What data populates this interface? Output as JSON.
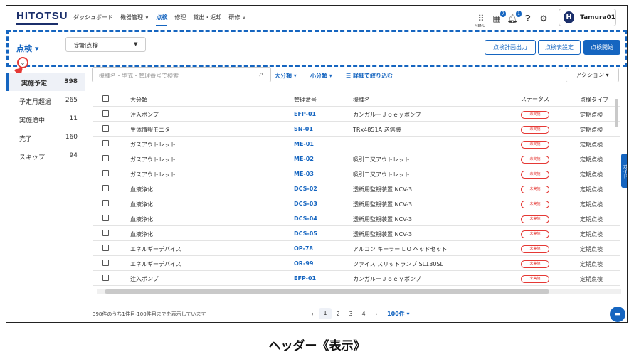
{
  "header": {
    "logo": "HITOTSU",
    "nav": [
      "ダッシュボード",
      "機器管理 ∨",
      "点検",
      "修理",
      "貸出・返却",
      "研修 ∨"
    ],
    "menu_label": "MENU",
    "badge1": "7",
    "badge2": "1",
    "user_initial": "H",
    "user_name": "Tamura01"
  },
  "toolbar": {
    "title": "点検 ▾",
    "select_value": "定期点検",
    "btn_plan": "点検計画出力",
    "btn_settings": "点検表設定",
    "btn_start": "点検開始"
  },
  "sidebar": {
    "items": [
      {
        "label": "実施予定",
        "count": "398"
      },
      {
        "label": "予定月超過",
        "count": "265"
      },
      {
        "label": "実施途中",
        "count": "11"
      },
      {
        "label": "完了",
        "count": "160"
      },
      {
        "label": "スキップ",
        "count": "94"
      }
    ]
  },
  "filters": {
    "search_placeholder": "機種名・型式・管理番号で検索",
    "large": "大分類 ▾",
    "small": "小分類 ▾",
    "detail": "詳細で絞り込む",
    "action": "アクション ▾"
  },
  "table": {
    "headers": [
      "大分類",
      "管理番号",
      "機種名",
      "ステータス",
      "点検タイプ"
    ],
    "rows": [
      {
        "cat": "注入ポンプ",
        "id": "EFP-01",
        "model": "カンガルーＪｏｅｙポンプ",
        "status": "未実施",
        "type": "定期点検"
      },
      {
        "cat": "生体情報モニタ",
        "id": "SN-01",
        "model": "TRx4851A 送信機",
        "status": "未実施",
        "type": "定期点検"
      },
      {
        "cat": "ガスアウトレット",
        "id": "ME-01",
        "model": "",
        "status": "未実施",
        "type": "定期点検"
      },
      {
        "cat": "ガスアウトレット",
        "id": "ME-02",
        "model": "吸引二又アウトレット",
        "status": "未実施",
        "type": "定期点検"
      },
      {
        "cat": "ガスアウトレット",
        "id": "ME-03",
        "model": "吸引二又アウトレット",
        "status": "未実施",
        "type": "定期点検"
      },
      {
        "cat": "血液浄化",
        "id": "DCS-02",
        "model": "透析用監視装置 NCV-3",
        "status": "未実施",
        "type": "定期点検"
      },
      {
        "cat": "血液浄化",
        "id": "DCS-03",
        "model": "透析用監視装置 NCV-3",
        "status": "未実施",
        "type": "定期点検"
      },
      {
        "cat": "血液浄化",
        "id": "DCS-04",
        "model": "透析用監視装置 NCV-3",
        "status": "未実施",
        "type": "定期点検"
      },
      {
        "cat": "血液浄化",
        "id": "DCS-05",
        "model": "透析用監視装置 NCV-3",
        "status": "未実施",
        "type": "定期点検"
      },
      {
        "cat": "エネルギーデバイス",
        "id": "OP-78",
        "model": "アルコン キーラー LIO ヘッドセット",
        "status": "未実施",
        "type": "定期点検"
      },
      {
        "cat": "エネルギーデバイス",
        "id": "OR-99",
        "model": "ツァイス スリットランプ SL130SL",
        "status": "未実施",
        "type": "定期点検"
      },
      {
        "cat": "注入ポンプ",
        "id": "EFP-01",
        "model": "カンガルーＪｏｅｙポンプ",
        "status": "未実施",
        "type": "定期点検"
      }
    ]
  },
  "guide_tab": "ガイド",
  "footer": {
    "summary": "398件のうち1件目-100件目までを表示しています",
    "pages": [
      "‹",
      "1",
      "2",
      "3",
      "4",
      "›"
    ],
    "per_page": "100件 ▾"
  },
  "caption": "ヘッダー《表示》",
  "colors": {
    "accent": "#1565c0",
    "brand": "#1b2f6b",
    "alert": "#e53935"
  }
}
